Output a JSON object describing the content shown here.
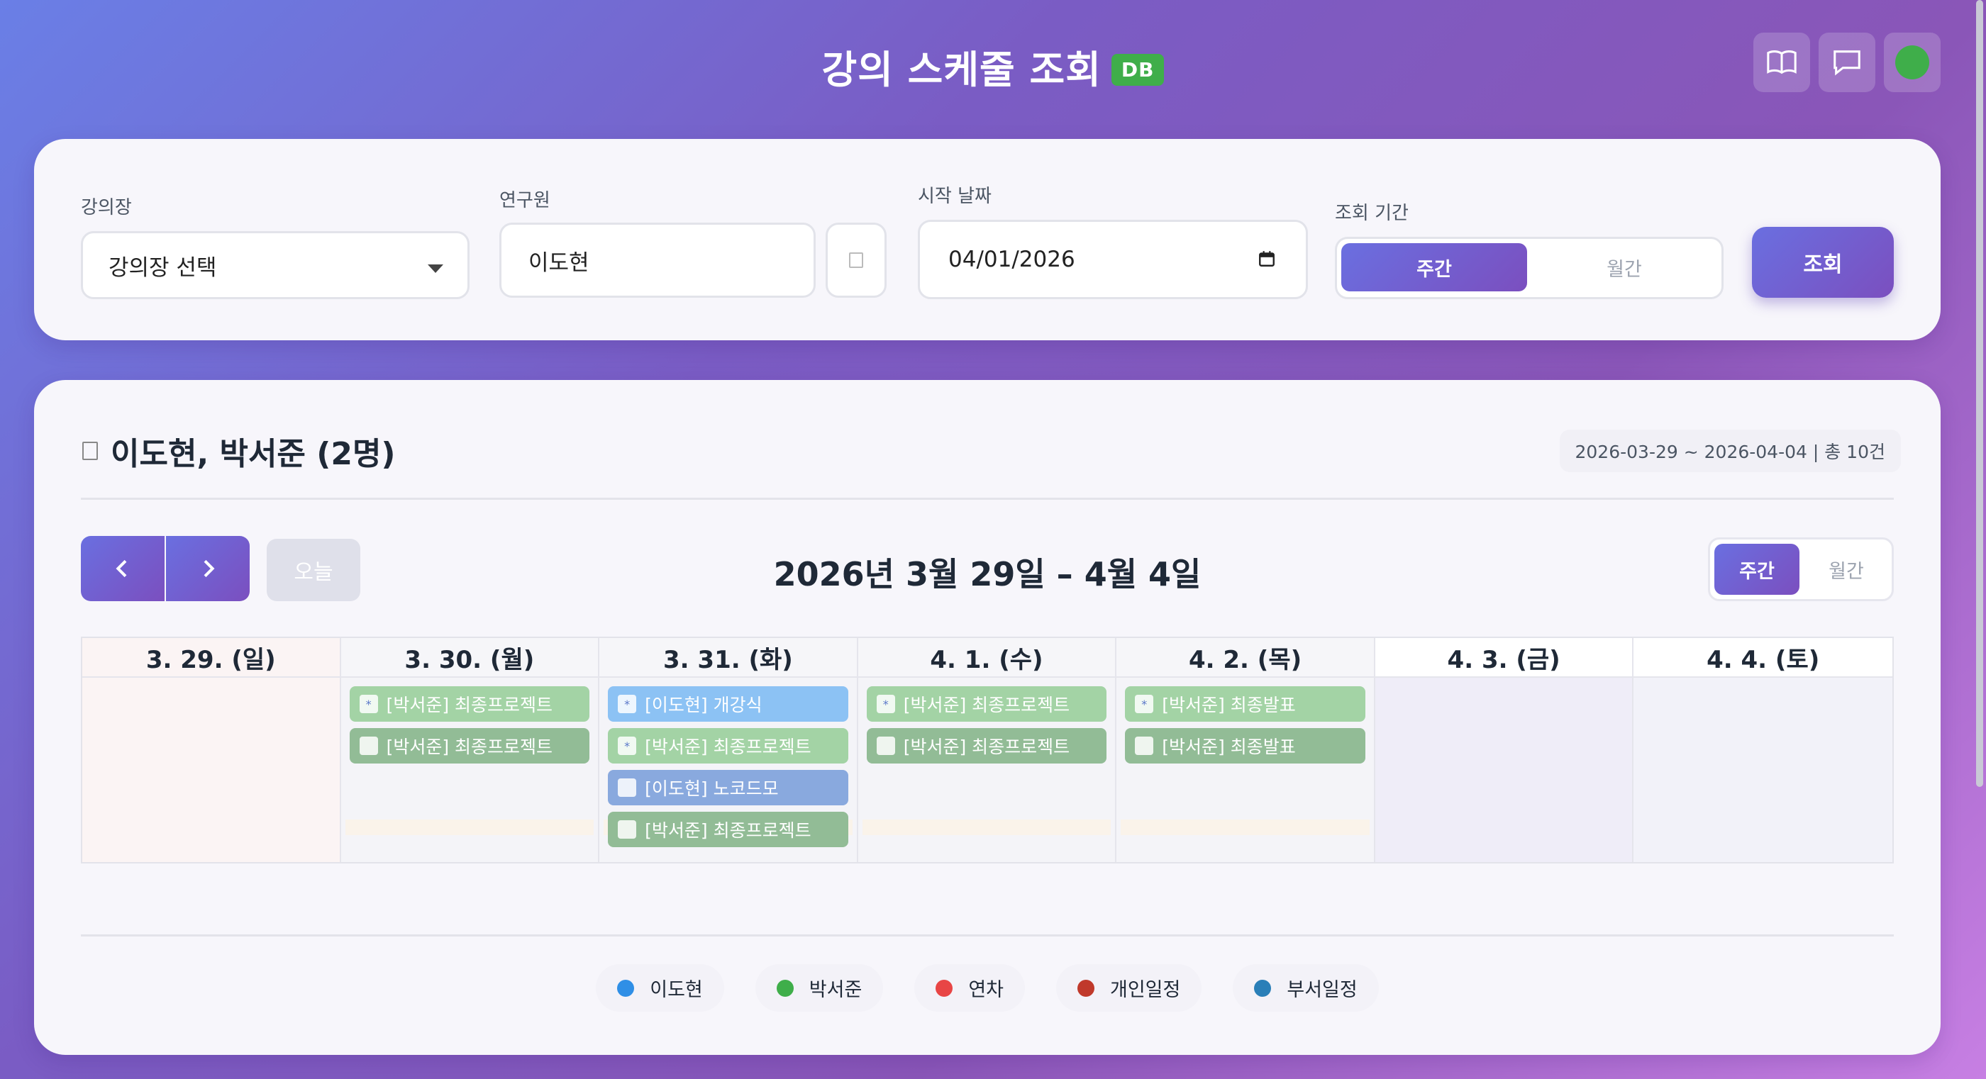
{
  "header": {
    "title": "강의 스케줄 조회",
    "badge": "DB",
    "buttons": [
      {
        "name": "guide-book-icon"
      },
      {
        "name": "chat-icon"
      },
      {
        "name": "status-indicator",
        "color": "#3fae4a"
      }
    ]
  },
  "filters": {
    "room_label": "강의장",
    "room_value": "강의장 선택",
    "researcher_label": "연구원",
    "researcher_value": "이도현",
    "start_date_label": "시작 날짜",
    "start_date_value": "04/01/2026",
    "period_label": "조회 기간",
    "period_options": [
      "주간",
      "월간"
    ],
    "period_selected": "주간",
    "search_label": "조회"
  },
  "summary": {
    "title": "이도현, 박서준 (2명)",
    "range": "2026-03-29 ~ 2026-04-04 | 총 10건"
  },
  "calendar": {
    "today_label": "오늘",
    "period_title": "2026년 3월 29일 – 4월 4일",
    "view_options": [
      "주간",
      "월간"
    ],
    "view_selected": "주간",
    "days": [
      {
        "label": "3. 29. (일)",
        "events": []
      },
      {
        "label": "3. 30. (월)",
        "events": [
          {
            "text": "[박서준] 최종프로젝트",
            "style": "green-light",
            "icon": "*"
          },
          {
            "text": "[박서준] 최종프로젝트",
            "style": "green-dark",
            "icon": ""
          }
        ]
      },
      {
        "label": "3. 31. (화)",
        "events": [
          {
            "text": "[이도현] 개강식",
            "style": "blue-light",
            "icon": "*"
          },
          {
            "text": "[박서준] 최종프로젝트",
            "style": "green-light",
            "icon": "*"
          },
          {
            "text": "[이도현] 노코드모",
            "style": "blue-mid",
            "icon": ""
          },
          {
            "text": "[박서준] 최종프로젝트",
            "style": "green-dark",
            "icon": ""
          }
        ]
      },
      {
        "label": "4. 1. (수)",
        "events": [
          {
            "text": "[박서준] 최종프로젝트",
            "style": "green-light",
            "icon": "*"
          },
          {
            "text": "[박서준] 최종프로젝트",
            "style": "green-dark",
            "icon": ""
          }
        ]
      },
      {
        "label": "4. 2. (목)",
        "events": [
          {
            "text": "[박서준] 최종발표",
            "style": "green-light",
            "icon": "*"
          },
          {
            "text": "[박서준] 최종발표",
            "style": "green-dark",
            "icon": ""
          }
        ]
      },
      {
        "label": "4. 3. (금)",
        "events": []
      },
      {
        "label": "4. 4. (토)",
        "events": []
      }
    ]
  },
  "legend": [
    {
      "label": "이도현",
      "color": "#2f8fe6"
    },
    {
      "label": "박서준",
      "color": "#3fae4a"
    },
    {
      "label": "연차",
      "color": "#e84545"
    },
    {
      "label": "개인일정",
      "color": "#c0392b"
    },
    {
      "label": "부서일정",
      "color": "#2a7fb8"
    }
  ]
}
